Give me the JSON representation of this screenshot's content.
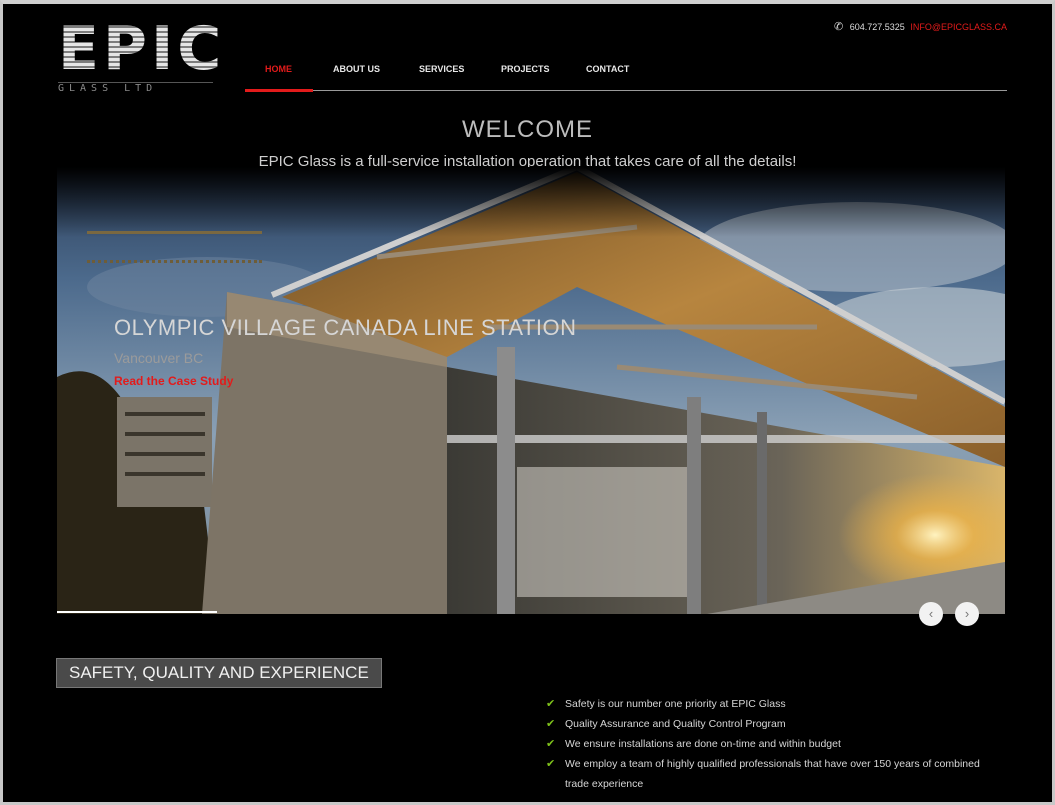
{
  "brand": {
    "name": "EPIC",
    "sub": "GLASS LTD"
  },
  "contact": {
    "phone": "604.727.5325",
    "email": "INFO@EPICGLASS.CA"
  },
  "nav": {
    "items": [
      "HOME",
      "ABOUT US",
      "SERVICES",
      "PROJECTS",
      "CONTACT"
    ],
    "active": "HOME"
  },
  "hero": {
    "welcome": "WELCOME",
    "tagline": "EPIC Glass is a full-service installation operation that takes care of all the details!"
  },
  "slide": {
    "title": "OLYMPIC VILLAGE CANADA LINE STATION",
    "location": "Vancouver BC",
    "link": "Read the Case Study"
  },
  "slider_controls": {
    "prev": "‹",
    "next": "›"
  },
  "section": {
    "title": "SAFETY, QUALITY AND EXPERIENCE",
    "items": [
      "Safety is our number one priority at EPIC Glass",
      "Quality Assurance and Quality Control Program",
      "We ensure installations are done on-time and within budget",
      "We employ a team of highly qualified professionals that have over 150 years of combined trade experience"
    ]
  },
  "colors": {
    "accent": "#e31b1b",
    "check": "#7fc21b",
    "background": "#000000"
  }
}
